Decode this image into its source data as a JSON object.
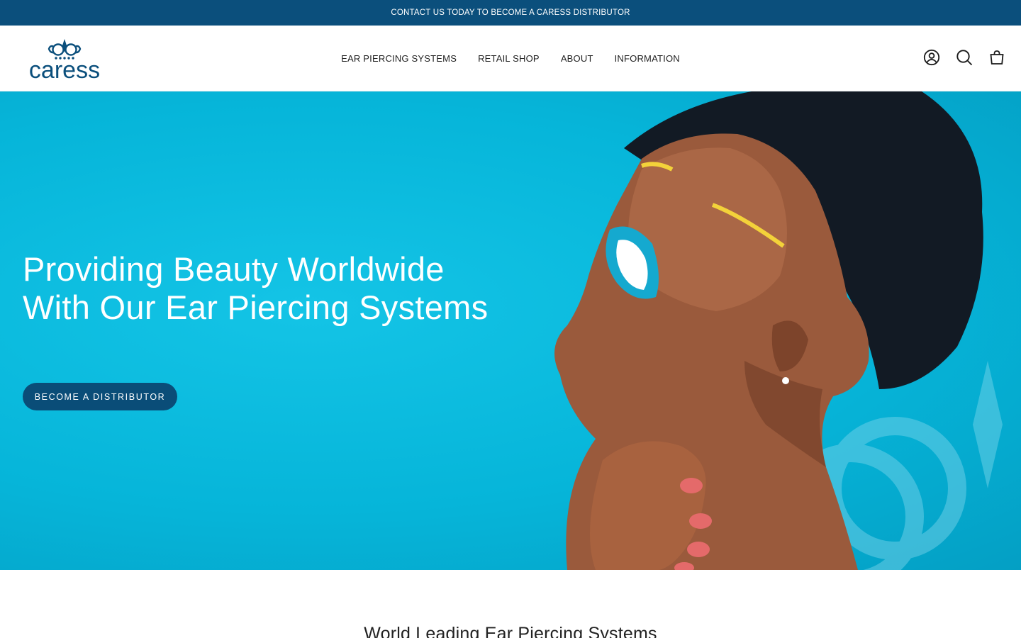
{
  "announcement": {
    "text": "CONTACT US TODAY TO BECOME A CARESS DISTRIBUTOR"
  },
  "header": {
    "logo_text": "caress",
    "nav": [
      {
        "label": "EAR PIERCING SYSTEMS"
      },
      {
        "label": "RETAIL SHOP"
      },
      {
        "label": "ABOUT"
      },
      {
        "label": "INFORMATION"
      }
    ],
    "icons": [
      "account-icon",
      "search-icon",
      "cart-icon"
    ]
  },
  "hero": {
    "title": "Providing Beauty Worldwide With Our Ear Piercing Systems",
    "button_label": "BECOME A DISTRIBUTOR"
  },
  "section": {
    "title": "World Leading Ear Piercing Systems"
  },
  "colors": {
    "brand_navy": "#0b4f7c",
    "hero_cyan": "#06b9dc",
    "button_bg": "#0a4d78"
  }
}
